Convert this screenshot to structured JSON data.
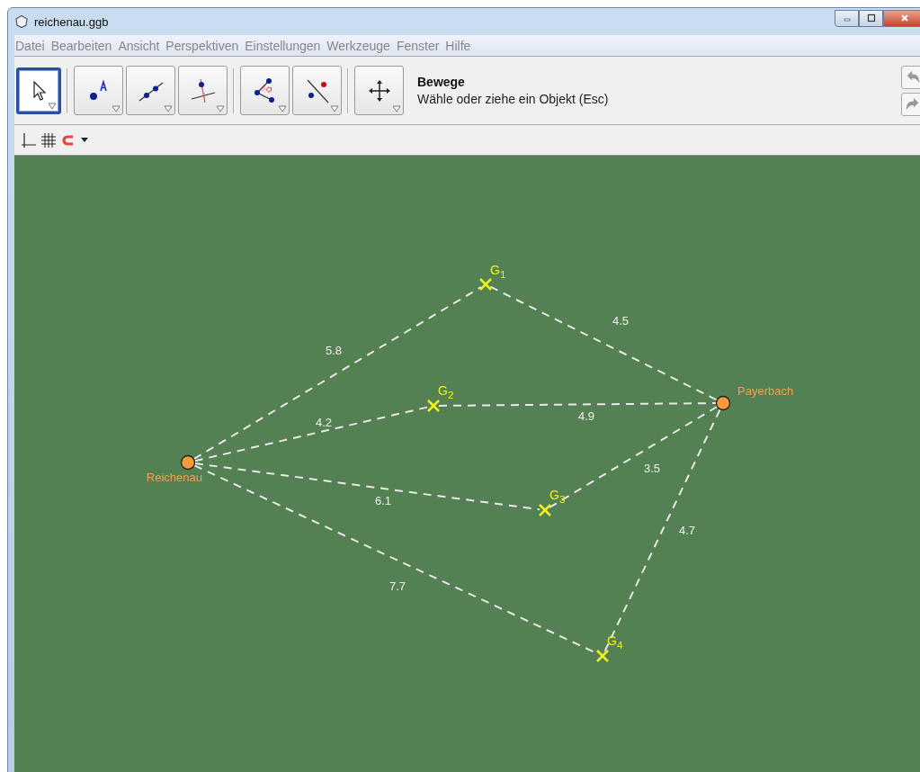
{
  "window": {
    "title": "reichenau.ggb"
  },
  "menu": [
    "Datei",
    "Bearbeiten",
    "Ansicht",
    "Perspektiven",
    "Einstellungen",
    "Werkzeuge",
    "Fenster",
    "Hilfe"
  ],
  "tools": [
    {
      "selected": true
    },
    {
      "selected": false
    },
    {
      "selected": false
    },
    {
      "selected": false
    },
    {
      "selected": false
    },
    {
      "selected": false
    },
    {
      "selected": false
    }
  ],
  "tool_info": {
    "name": "Bewege",
    "help": "Wähle oder ziehe ein Objekt (Esc)"
  },
  "points": [
    {
      "name": "Reichenau",
      "kind": "town"
    },
    {
      "name": "Payerbach",
      "kind": "town"
    },
    {
      "name": "G$_{1}$",
      "kind": "waypoint"
    },
    {
      "name": "G$_{2}$",
      "kind": "waypoint"
    },
    {
      "name": "G$_{3}$",
      "kind": "waypoint"
    },
    {
      "name": "G$_{4}$",
      "kind": "waypoint"
    }
  ],
  "segments": [
    {
      "label": "5.8"
    },
    {
      "label": "4.5"
    },
    {
      "label": "4.2"
    },
    {
      "label": "4.9"
    },
    {
      "label": "6.1"
    },
    {
      "label": "3.5"
    },
    {
      "label": "7.7"
    },
    {
      "label": "4.7"
    }
  ]
}
